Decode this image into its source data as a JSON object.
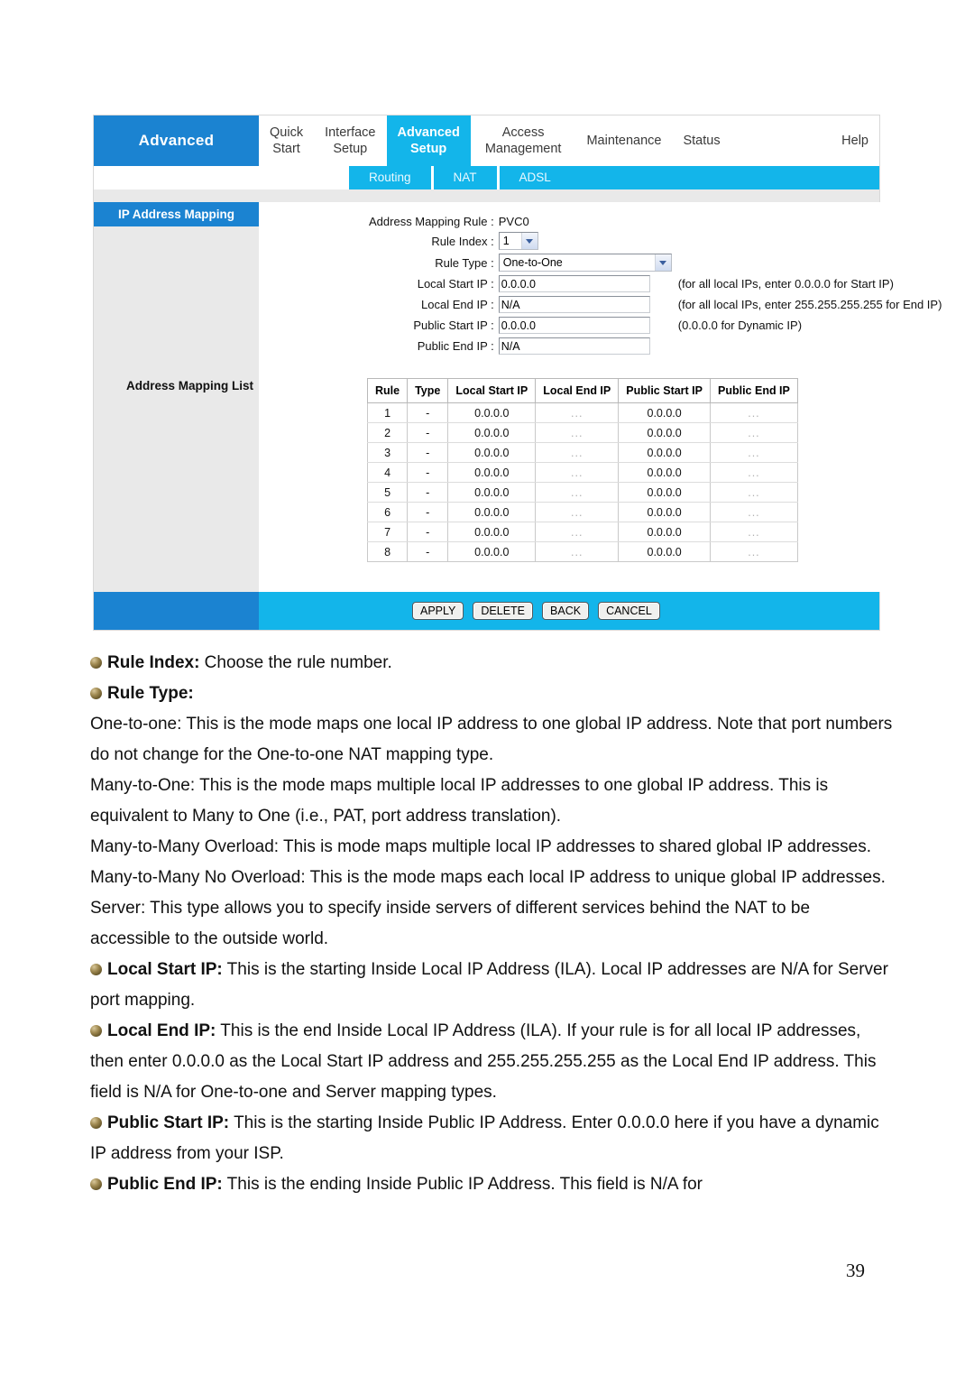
{
  "router_ui": {
    "brand_label": "Advanced",
    "nav_tabs": [
      {
        "line1": "Quick",
        "line2": "Start",
        "active": false
      },
      {
        "line1": "Interface",
        "line2": "Setup",
        "active": false
      },
      {
        "line1": "Advanced",
        "line2": "Setup",
        "active": true
      },
      {
        "line1": "Access",
        "line2": "Management",
        "active": false
      },
      {
        "line1": "Maintenance",
        "line2": "",
        "active": false
      },
      {
        "line1": "Status",
        "line2": "",
        "active": false
      },
      {
        "line1": "Help",
        "line2": "",
        "active": false
      }
    ],
    "subnav": [
      "Routing",
      "NAT",
      "ADSL"
    ],
    "sidebar": {
      "section_title": "IP Address Mapping",
      "list_title": "Address Mapping List"
    },
    "form": {
      "rows": [
        {
          "label": "Address Mapping Rule :",
          "kind": "static",
          "value": "PVC0",
          "hint": ""
        },
        {
          "label": "Rule Index :",
          "kind": "select-small",
          "value": "1",
          "hint": ""
        },
        {
          "label": "Rule Type :",
          "kind": "select-big",
          "value": "One-to-One",
          "hint": ""
        },
        {
          "label": "Local Start IP :",
          "kind": "text",
          "value": "0.0.0.0",
          "hint": "(for all local IPs, enter 0.0.0.0 for Start IP)"
        },
        {
          "label": "Local End IP :",
          "kind": "text",
          "value": "N/A",
          "hint": "(for all local IPs, enter 255.255.255.255 for End IP)"
        },
        {
          "label": "Public Start IP :",
          "kind": "text",
          "value": "0.0.0.0",
          "hint": "(0.0.0.0 for Dynamic IP)"
        },
        {
          "label": "Public End IP :",
          "kind": "text",
          "value": "N/A",
          "hint": ""
        }
      ]
    },
    "mapping_list": {
      "columns": [
        "Rule",
        "Type",
        "Local Start IP",
        "Local End IP",
        "Public Start IP",
        "Public End IP"
      ],
      "rows": [
        {
          "rule": "1",
          "type": "-",
          "local_start": "0.0.0.0",
          "local_end": "...",
          "public_start": "0.0.0.0",
          "public_end": "..."
        },
        {
          "rule": "2",
          "type": "-",
          "local_start": "0.0.0.0",
          "local_end": "...",
          "public_start": "0.0.0.0",
          "public_end": "..."
        },
        {
          "rule": "3",
          "type": "-",
          "local_start": "0.0.0.0",
          "local_end": "...",
          "public_start": "0.0.0.0",
          "public_end": "..."
        },
        {
          "rule": "4",
          "type": "-",
          "local_start": "0.0.0.0",
          "local_end": "...",
          "public_start": "0.0.0.0",
          "public_end": "..."
        },
        {
          "rule": "5",
          "type": "-",
          "local_start": "0.0.0.0",
          "local_end": "...",
          "public_start": "0.0.0.0",
          "public_end": "..."
        },
        {
          "rule": "6",
          "type": "-",
          "local_start": "0.0.0.0",
          "local_end": "...",
          "public_start": "0.0.0.0",
          "public_end": "..."
        },
        {
          "rule": "7",
          "type": "-",
          "local_start": "0.0.0.0",
          "local_end": "...",
          "public_start": "0.0.0.0",
          "public_end": "..."
        },
        {
          "rule": "8",
          "type": "-",
          "local_start": "0.0.0.0",
          "local_end": "...",
          "public_start": "0.0.0.0",
          "public_end": "..."
        }
      ]
    },
    "buttons": [
      "APPLY",
      "DELETE",
      "BACK",
      "CANCEL"
    ],
    "colors": {
      "brand_blue": "#1b83d1",
      "accent_cyan": "#13b5ea",
      "sidebar_grey": "#e9e9e9"
    }
  },
  "prose": {
    "rule_index_term": "Rule Index:",
    "rule_index_desc": " Choose the rule number.",
    "rule_type_term": "Rule Type:",
    "paragraphs": [
      "One-to-one: This is the mode maps one local IP address to one global IP address. Note that port numbers do not change for the One-to-one NAT mapping type.",
      "Many-to-One: This is the mode maps multiple local IP addresses to one global IP address. This is equivalent to Many to One (i.e., PAT, port address translation).",
      "Many-to-Many Overload: This is mode maps multiple local IP addresses to shared global IP addresses.",
      "Many-to-Many No Overload: This is the mode maps each local IP address to unique global IP addresses.",
      "Server: This type allows you to specify inside servers of different services behind the NAT to be accessible to the outside world."
    ],
    "local_start_term": "Local Start IP:",
    "local_start_desc": " This is the starting Inside Local IP Address (ILA). Local IP addresses are N/A for Server port mapping.",
    "local_end_term": "Local End IP:",
    "local_end_desc": " This is the end Inside Local IP Address (ILA). If your rule is for all local IP addresses, then enter 0.0.0.0 as the Local Start IP address and 255.255.255.255 as the Local End IP address. This field is N/A for One-to-one and Server mapping types.",
    "public_start_term": "Public Start IP:",
    "public_start_desc": " This is the starting Inside Public IP Address. Enter 0.0.0.0 here if you have a dynamic IP address from your ISP.",
    "public_end_term": "Public End IP:",
    "public_end_desc": " This is the ending Inside Public IP Address. This field is N/A for"
  },
  "page_number": "39"
}
